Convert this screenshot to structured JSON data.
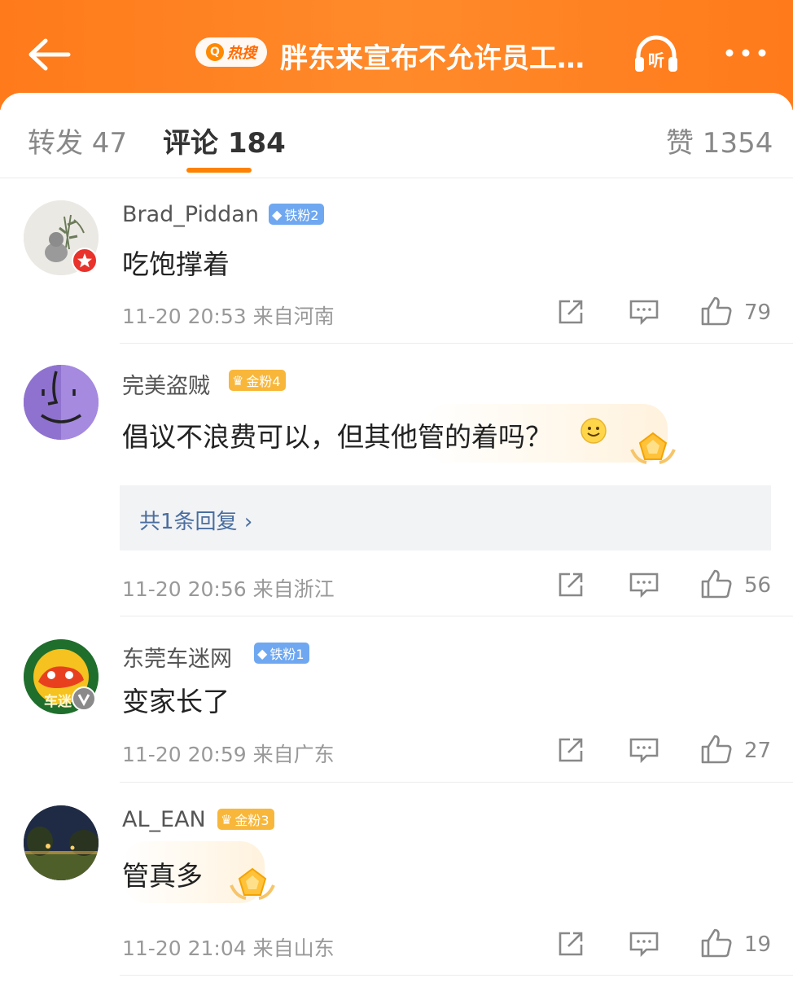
{
  "header": {
    "hot_label": "热搜",
    "title": "胖东来宣布不允许员工…",
    "listen_label": "听",
    "colors": {
      "bar": "#ff7a1a",
      "text": "#ffffff"
    }
  },
  "tabs": {
    "repost": "转发 47",
    "comments": "评论 184",
    "likes": "赞 1354",
    "accent": "#ff8200"
  },
  "comments": [
    {
      "user": "Brad_Piddan",
      "badge": "铁粉2",
      "badge_type": "iron",
      "text": "吃饱撑着",
      "time": "11-20 20:53",
      "location": "来自河南",
      "likes": "79"
    },
    {
      "user": "完美盗贼",
      "badge": "金粉4",
      "badge_type": "gold",
      "text": "倡议不浪费可以，但其他管的着吗？",
      "time": "11-20 20:56",
      "location": "来自浙江",
      "likes": "56",
      "reply": "共1条回复"
    },
    {
      "user": "东莞车迷网",
      "badge": "铁粉1",
      "badge_type": "iron",
      "text": "变家长了",
      "time": "11-20 20:59",
      "location": "来自广东",
      "likes": "27",
      "avatar_text": "车迷"
    },
    {
      "user": "AL_EAN",
      "badge": "金粉3",
      "badge_type": "gold",
      "text": "管真多",
      "time": "11-20 21:04",
      "location": "来自山东",
      "likes": "19"
    }
  ]
}
